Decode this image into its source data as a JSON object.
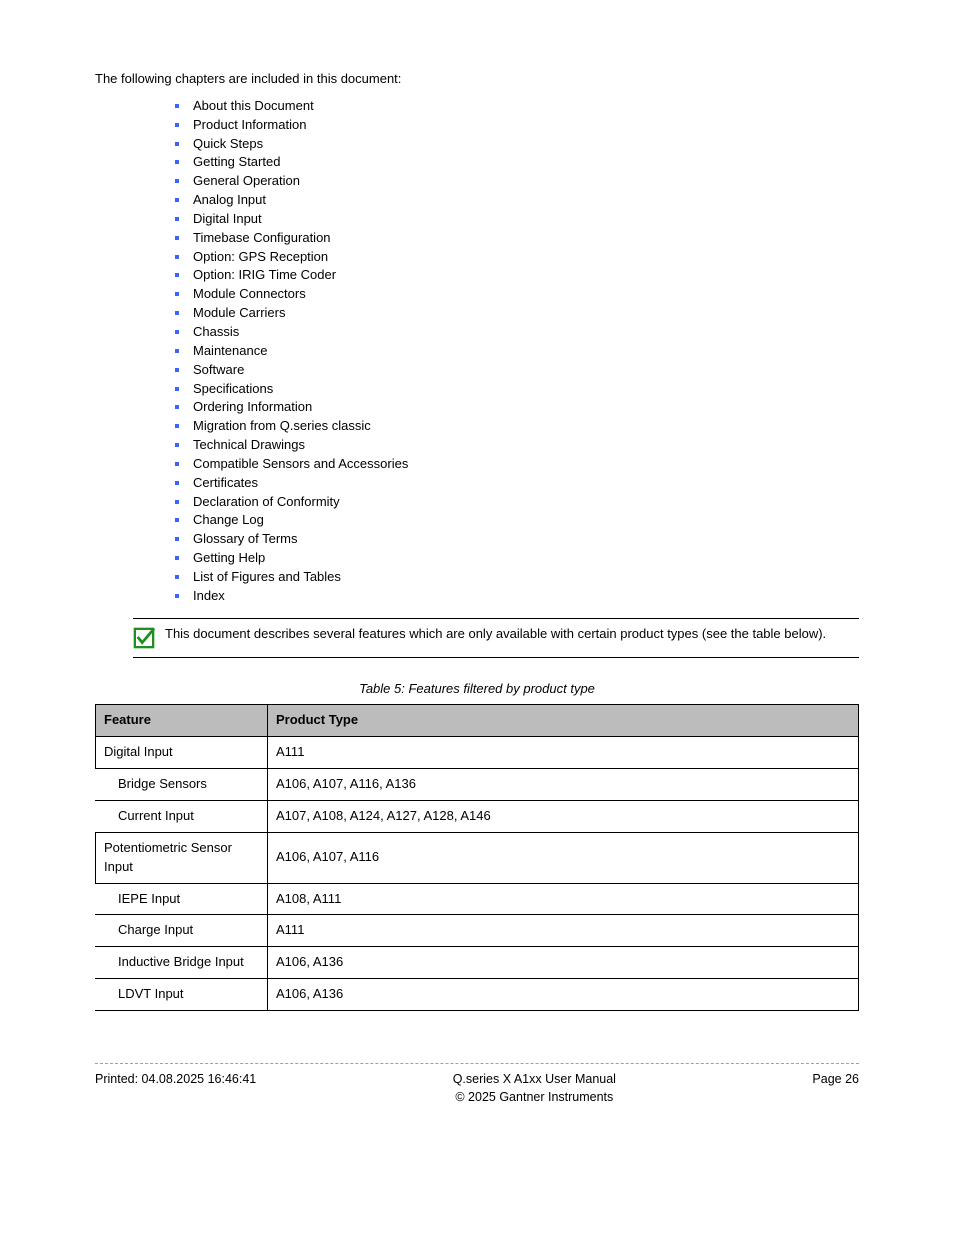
{
  "intro": "The following chapters are included in this document:",
  "bullets": [
    "About this Document",
    "Product Information",
    "Quick Steps",
    "Getting Started",
    "General Operation",
    "Analog Input",
    "Digital Input",
    "Timebase Configuration",
    "Option: GPS Reception",
    "Option: IRIG Time Coder",
    "Module Connectors",
    "Module Carriers",
    "Chassis",
    "Maintenance",
    "Software",
    "Specifications",
    "Ordering Information",
    "Migration from Q.series classic",
    "Technical Drawings",
    "Compatible Sensors and Accessories",
    "Certificates",
    "Declaration of Conformity",
    "Change Log",
    "Glossary of Terms",
    "Getting Help",
    "List of Figures and Tables",
    "Index"
  ],
  "note": "This document describes several features which are only available with certain product types (see the table below).",
  "table_caption": "Table 5: Features filtered by product type",
  "table": {
    "headers": [
      "Feature",
      "Product Type"
    ],
    "rows": [
      {
        "label": "Digital Input",
        "value": "A111",
        "indent": false
      },
      {
        "label": "Bridge Sensors",
        "value": "A106, A107, A116, A136",
        "indent": true
      },
      {
        "label": "Current Input",
        "value": "A107, A108, A124, A127, A128, A146",
        "indent": true
      },
      {
        "label": "Potentiometric Sensor Input",
        "value": "A106, A107, A116",
        "indent": false
      },
      {
        "label": "IEPE Input",
        "value": "A108, A111",
        "indent": true
      },
      {
        "label": "Charge Input",
        "value": "A111",
        "indent": true
      },
      {
        "label": "Inductive Bridge Input",
        "value": "A106, A136",
        "indent": true
      },
      {
        "label": "LDVT Input",
        "value": "A106, A136",
        "indent": true
      }
    ]
  },
  "footer": {
    "left": "Printed: 04.08.2025 16:46:41",
    "mid_line1": "Q.series X A1xx User Manual",
    "mid_line2": "© 2025 Gantner Instruments",
    "right": "Page 26"
  }
}
